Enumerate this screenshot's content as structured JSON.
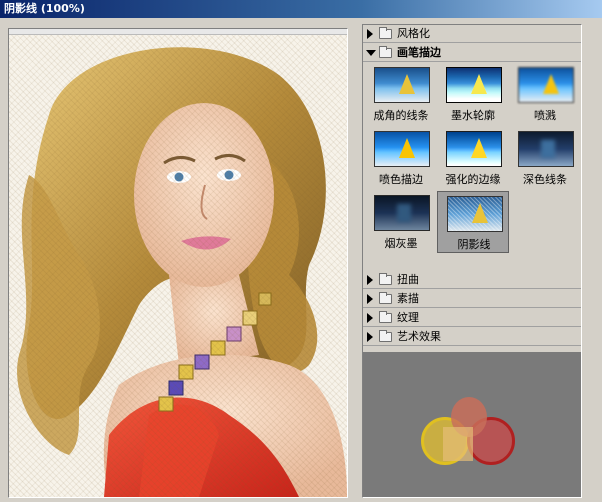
{
  "window": {
    "title": "阴影线 (100%)"
  },
  "filters": {
    "categories_top": [
      {
        "label": "风格化",
        "expanded": false
      }
    ],
    "open_category": {
      "label": "画笔描边",
      "expanded": true
    },
    "thumbnails": [
      {
        "label": "成角的线条"
      },
      {
        "label": "墨水轮廓"
      },
      {
        "label": "喷溅"
      },
      {
        "label": "喷色描边"
      },
      {
        "label": "强化的边缘"
      },
      {
        "label": "深色线条"
      },
      {
        "label": "烟灰墨"
      },
      {
        "label": "阴影线",
        "selected": true
      }
    ],
    "categories_bottom": [
      {
        "label": "扭曲"
      },
      {
        "label": "素描"
      },
      {
        "label": "纹理"
      },
      {
        "label": "艺术效果"
      }
    ]
  }
}
